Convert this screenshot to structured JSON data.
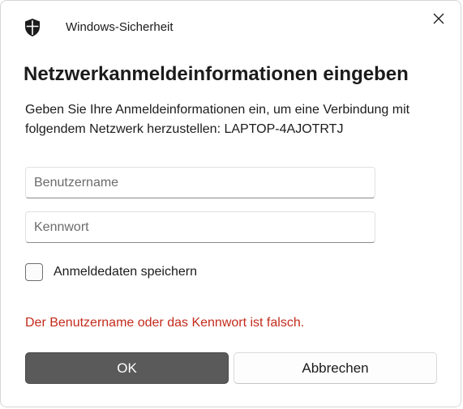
{
  "window": {
    "app_title": "Windows-Sicherheit",
    "app_icon": "shield-icon",
    "close_icon": "close-icon"
  },
  "dialog": {
    "heading": "Netzwerkanmeldeinformationen eingeben",
    "description": "Geben Sie Ihre Anmeldeinformationen ein, um eine Verbindung mit folgendem Netzwerk herzustellen: LAPTOP-4AJOTRTJ"
  },
  "form": {
    "username": {
      "value": "",
      "placeholder": "Benutzername"
    },
    "password": {
      "value": "",
      "placeholder": "Kennwort"
    },
    "remember": {
      "label": "Anmeldedaten speichern",
      "checked": false
    }
  },
  "error": {
    "message": "Der Benutzername oder das Kennwort ist falsch.",
    "color": "#c42b1c"
  },
  "buttons": {
    "ok_label": "OK",
    "cancel_label": "Abbrechen"
  }
}
